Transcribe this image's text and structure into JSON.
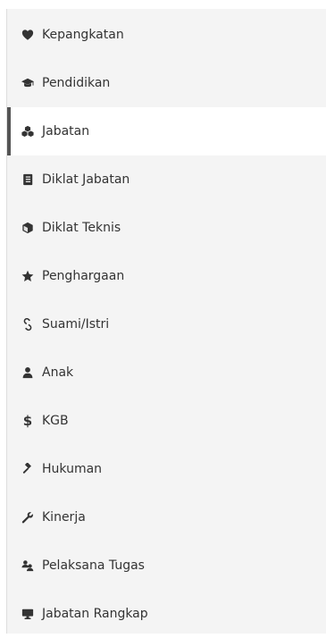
{
  "menu": {
    "items": [
      {
        "label": "Kepangkatan",
        "icon": "heart-icon",
        "active": false
      },
      {
        "label": "Pendidikan",
        "icon": "graduation-cap-icon",
        "active": false
      },
      {
        "label": "Jabatan",
        "icon": "cubes-icon",
        "active": true
      },
      {
        "label": "Diklat Jabatan",
        "icon": "book-icon",
        "active": false
      },
      {
        "label": "Diklat Teknis",
        "icon": "cube-icon",
        "active": false
      },
      {
        "label": "Penghargaan",
        "icon": "star-icon",
        "active": false
      },
      {
        "label": "Suami/Istri",
        "icon": "link-icon",
        "active": false
      },
      {
        "label": "Anak",
        "icon": "user-icon",
        "active": false
      },
      {
        "label": "KGB",
        "icon": "dollar-icon",
        "active": false
      },
      {
        "label": "Hukuman",
        "icon": "gavel-icon",
        "active": false
      },
      {
        "label": "Kinerja",
        "icon": "wrench-icon",
        "active": false
      },
      {
        "label": "Pelaksana Tugas",
        "icon": "users-icon",
        "active": false
      },
      {
        "label": "Jabatan Rangkap",
        "icon": "desktop-icon",
        "active": false
      }
    ]
  },
  "colors": {
    "sidebar_background": "#f4f4f4",
    "active_background": "#ffffff",
    "active_border": "#555555",
    "text": "#333333"
  }
}
